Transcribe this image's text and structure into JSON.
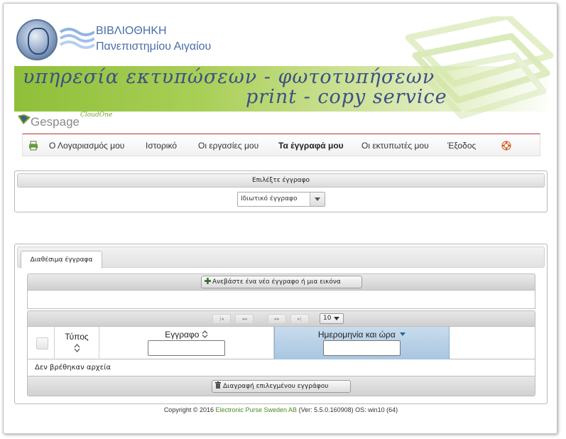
{
  "header": {
    "library_title": "ΒΙΒΛΙΟΘΗΚΗ",
    "library_subtitle": "Πανεπιστημίου Αιγαίου",
    "banner_line1": "υπηρεσία εκτυπώσεων - φωτοτυπήσεων",
    "banner_line2": "print - copy service",
    "brand": "Gespage",
    "brand_sub": "CloudOne",
    "colors": {
      "banner_green": "#8fbf3a",
      "banner_text": "#3d4f86",
      "title_blue": "#4a6fa5"
    }
  },
  "nav": {
    "items": [
      {
        "label": "Ο Λογαριασμός μου",
        "icon": "printer-icon"
      },
      {
        "label": "Ιστορικό"
      },
      {
        "label": "Οι εργασίες μου"
      },
      {
        "label": "Τα έγγραφά μου",
        "active": true
      },
      {
        "label": "Οι εκτυπωτές μου"
      },
      {
        "label": "Έξοδος"
      }
    ],
    "help_icon": "lifebuoy-icon"
  },
  "select_document": {
    "title": "Επιλέξτε έγγραφο",
    "selected": "Ιδιωτικό έγγραφο"
  },
  "documents": {
    "tab_label": "Διαθέσιμα έγγραφα",
    "upload_button": "Ανεβάστε ένα νέο έγγραφο ή μια εικόνα",
    "pager": {
      "first": "|◂",
      "prev": "◂◂",
      "next": "▸▸",
      "last": "▸|",
      "page_size": "10"
    },
    "columns": {
      "type": "Τύπος",
      "document": "Εγγραφο",
      "datetime": "Ημερομηνία και ώρα"
    },
    "empty_message": "Δεν βρέθηκαν αρχεία",
    "delete_button": "Διαγραφή επιλεγμένου εγγράφου"
  },
  "footer": {
    "copyright_prefix": "Copyright © 2016",
    "company": "Electronic Purse Sweden AB",
    "version": "(Ver: 5.5.0.160908) OS: win10 (64)"
  }
}
